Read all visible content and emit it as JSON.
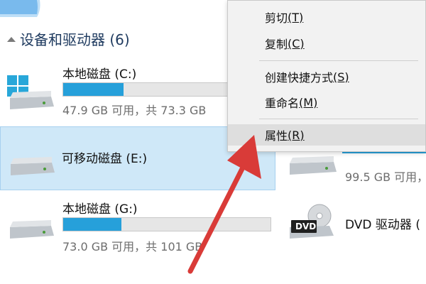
{
  "section": {
    "title": "设备和驱动器 (6)"
  },
  "drives": [
    {
      "name": "本地磁盘 (C:)",
      "usage_fraction": 0.35,
      "info": "47.9 GB 可用，共 73.3 GB"
    },
    {
      "name": "可移动磁盘 (E:)",
      "usage_fraction": null,
      "info": ""
    },
    {
      "name": "本地磁盘 (G:)",
      "usage_fraction": 0.28,
      "info": "73.0 GB 可用，共 101 GB"
    }
  ],
  "right_column": {
    "partial_drive_info": "99.5 GB 可用，",
    "dvd_label": "DVD 驱动器 (",
    "dvd_badge": "DVD"
  },
  "context_menu": {
    "items": [
      {
        "label": "剪切",
        "key": "(T)"
      },
      {
        "label": "复制",
        "key": "(C)"
      },
      {
        "label": "创建快捷方式",
        "key": "(S)"
      },
      {
        "label": "重命名",
        "key": "(M)"
      },
      {
        "label": "属性",
        "key": "(R)"
      }
    ]
  },
  "colors": {
    "accent": "#26a0da",
    "selected_bg": "#cfe8f8",
    "arrow": "#d93b38"
  },
  "icons": {
    "top_icon": "folder-icon",
    "windows_logo": "windows-logo-icon",
    "drive_icon": "drive-icon",
    "dvd_icon": "dvd-drive-icon",
    "arrow": "red-arrow-annotation"
  }
}
